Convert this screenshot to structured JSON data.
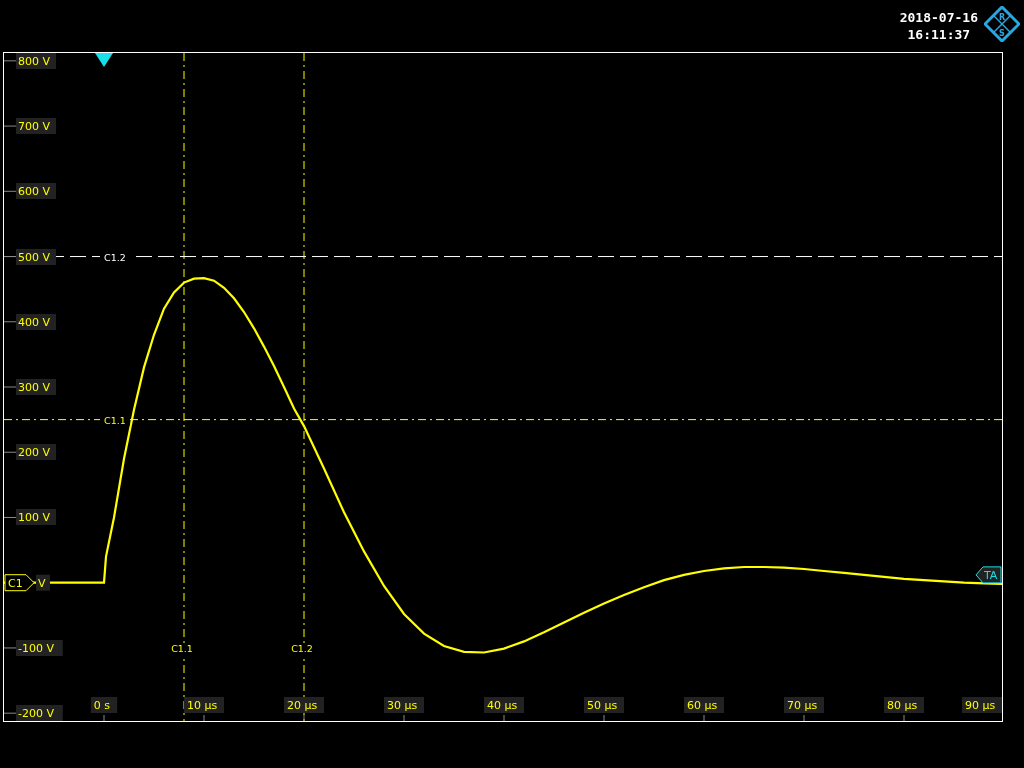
{
  "header": {
    "date": "2018-07-16",
    "time": "16:11:37",
    "logo": {
      "letters": [
        "R",
        "S"
      ]
    }
  },
  "scope": {
    "channel_unit": "V",
    "trigger_level_marker": "TA",
    "chart_data": {
      "type": "line",
      "xlim": [
        -10,
        90
      ],
      "ylim": [
        -212,
        812
      ],
      "ref_lines": [
        {
          "axis": "x",
          "value": 8,
          "label": "C1.1"
        },
        {
          "axis": "x",
          "value": 20,
          "label": "C1.2"
        },
        {
          "axis": "y",
          "value": 500,
          "label": "C1.2"
        },
        {
          "axis": "y",
          "value": 250,
          "label": "C1.1"
        }
      ],
      "xticks": [
        {
          "value": 0,
          "label": "0 s"
        },
        {
          "value": 10,
          "label": "10 µs"
        },
        {
          "value": 20,
          "label": "20 µs"
        },
        {
          "value": 30,
          "label": "30 µs"
        },
        {
          "value": 40,
          "label": "40 µs"
        },
        {
          "value": 50,
          "label": "50 µs"
        },
        {
          "value": 60,
          "label": "60 µs"
        },
        {
          "value": 70,
          "label": "70 µs"
        },
        {
          "value": 80,
          "label": "80 µs"
        },
        {
          "value": 90,
          "label": "90 µs"
        }
      ],
      "yticks": [
        {
          "value": 800,
          "label": "800 V"
        },
        {
          "value": 700,
          "label": "700 V"
        },
        {
          "value": 600,
          "label": "600 V"
        },
        {
          "value": 500,
          "label": "500 V"
        },
        {
          "value": 400,
          "label": "400 V"
        },
        {
          "value": 300,
          "label": "300 V"
        },
        {
          "value": 200,
          "label": "200 V"
        },
        {
          "value": 100,
          "label": "100 V"
        },
        {
          "value": -100,
          "label": "-100 V"
        },
        {
          "value": -200,
          "label": "-200 V"
        }
      ],
      "x": [
        -10,
        -5,
        0,
        0.2,
        1,
        2,
        3,
        4,
        5,
        6,
        7,
        8,
        9,
        10,
        11,
        12,
        13,
        14,
        15,
        16,
        17,
        18,
        19,
        20,
        22,
        24,
        26,
        28,
        30,
        32,
        34,
        36,
        38,
        40,
        42,
        44,
        46,
        48,
        50,
        52,
        54,
        56,
        58,
        60,
        62,
        64,
        66,
        68,
        70,
        72,
        74,
        76,
        78,
        80,
        82,
        84,
        86,
        88,
        90
      ],
      "series": [
        {
          "name": "C1",
          "color": "#ffff00",
          "values": [
            0,
            0,
            0,
            40,
            100,
            190,
            265,
            330,
            380,
            420,
            445,
            460,
            466,
            467,
            463,
            452,
            436,
            415,
            390,
            362,
            332,
            300,
            267,
            240,
            175,
            108,
            48,
            -5,
            -48,
            -78,
            -97,
            -106,
            -107,
            -101,
            -90,
            -76,
            -61,
            -46,
            -32,
            -19,
            -7,
            4,
            12,
            18,
            22,
            24,
            24,
            23,
            21,
            18,
            15,
            12,
            9,
            6,
            4,
            2,
            0,
            -1,
            -2
          ]
        }
      ]
    }
  }
}
